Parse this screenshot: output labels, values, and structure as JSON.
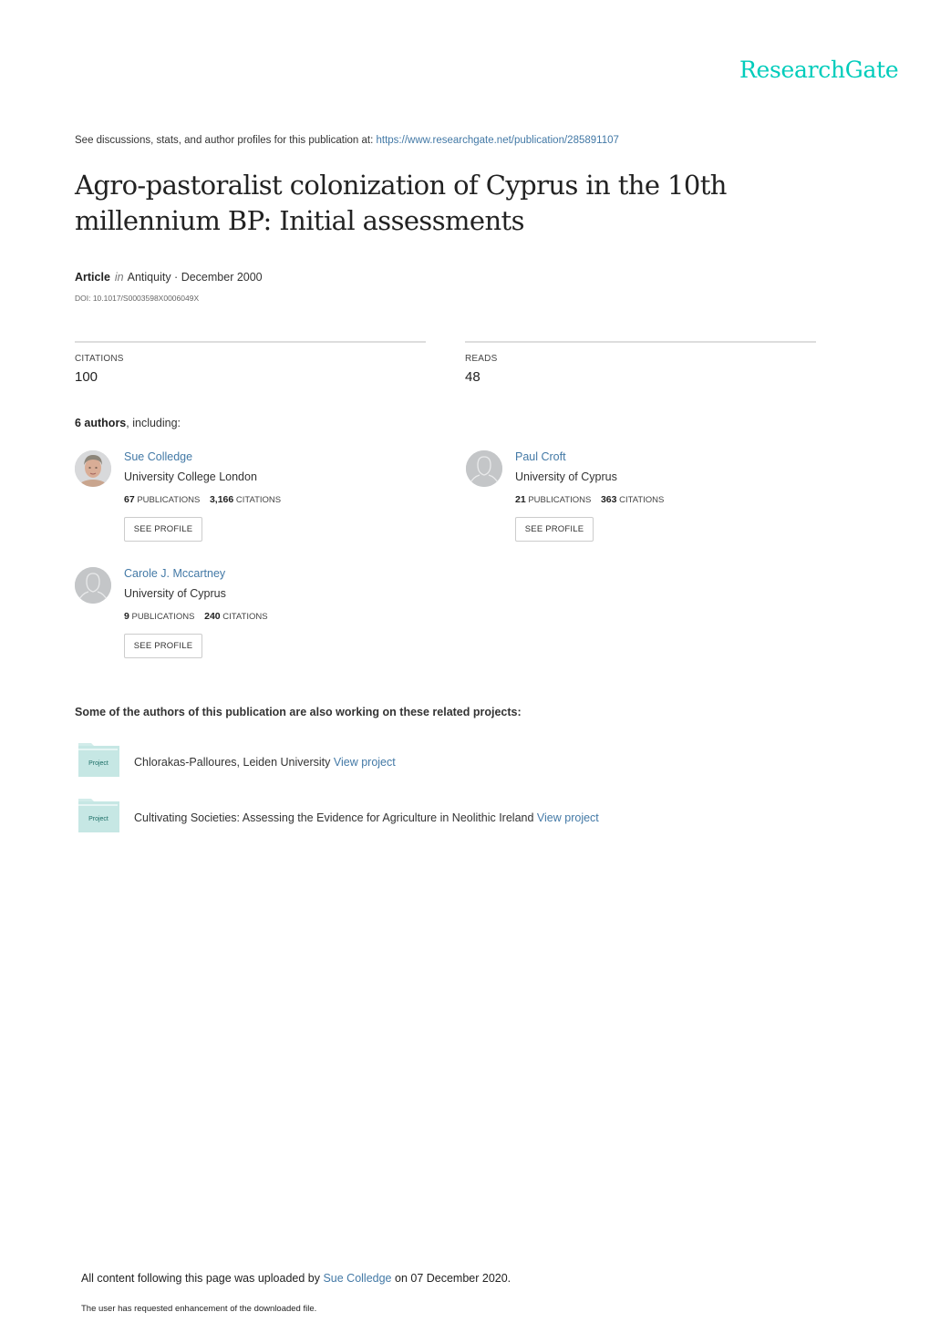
{
  "brand": {
    "name": "ResearchGate",
    "accent_color": "#00ccbb",
    "link_color": "#4379a6"
  },
  "intro": {
    "text": "See discussions, stats, and author profiles for this publication at: ",
    "url": "https://www.researchgate.net/publication/285891107"
  },
  "publication": {
    "title": "Agro-pastoralist colonization of Cyprus in the 10th millennium BP: Initial assessments",
    "type": "Article",
    "in_word": "in",
    "journal_date": "Antiquity · December 2000",
    "doi": "DOI: 10.1017/S0003598X0006049X"
  },
  "stats": {
    "citations_label": "CITATIONS",
    "citations_value": "100",
    "reads_label": "READS",
    "reads_value": "48"
  },
  "authors_section": {
    "count_text": "6 authors",
    "suffix": ", including:",
    "authors": [
      {
        "name": "Sue Colledge",
        "institution": "University College London",
        "publications": "67",
        "publications_label": "PUBLICATIONS",
        "citations": "3,166",
        "citations_label": "CITATIONS",
        "button": "SEE PROFILE",
        "avatar": "photo"
      },
      {
        "name": "Paul Croft",
        "institution": "University of Cyprus",
        "publications": "21",
        "publications_label": "PUBLICATIONS",
        "citations": "363",
        "citations_label": "CITATIONS",
        "button": "SEE PROFILE",
        "avatar": "placeholder-user-icon"
      },
      {
        "name": "Carole J. Mccartney",
        "institution": "University of Cyprus",
        "publications": "9",
        "publications_label": "PUBLICATIONS",
        "citations": "240",
        "citations_label": "CITATIONS",
        "button": "SEE PROFILE",
        "avatar": "placeholder-user-icon"
      }
    ]
  },
  "projects_section": {
    "heading": "Some of the authors of this publication are also working on these related projects:",
    "icon_label": "Project",
    "projects": [
      {
        "title": "Chlorakas-Palloures, Leiden University",
        "link": "View project"
      },
      {
        "title": "Cultivating Societies: Assessing the Evidence for Agriculture in Neolithic Ireland",
        "link": "View project"
      }
    ]
  },
  "footer": {
    "upload_prefix": "All content following this page was uploaded by ",
    "uploader": "Sue Colledge",
    "upload_suffix": " on 07 December 2020.",
    "enhancement": "The user has requested enhancement of the downloaded file."
  }
}
